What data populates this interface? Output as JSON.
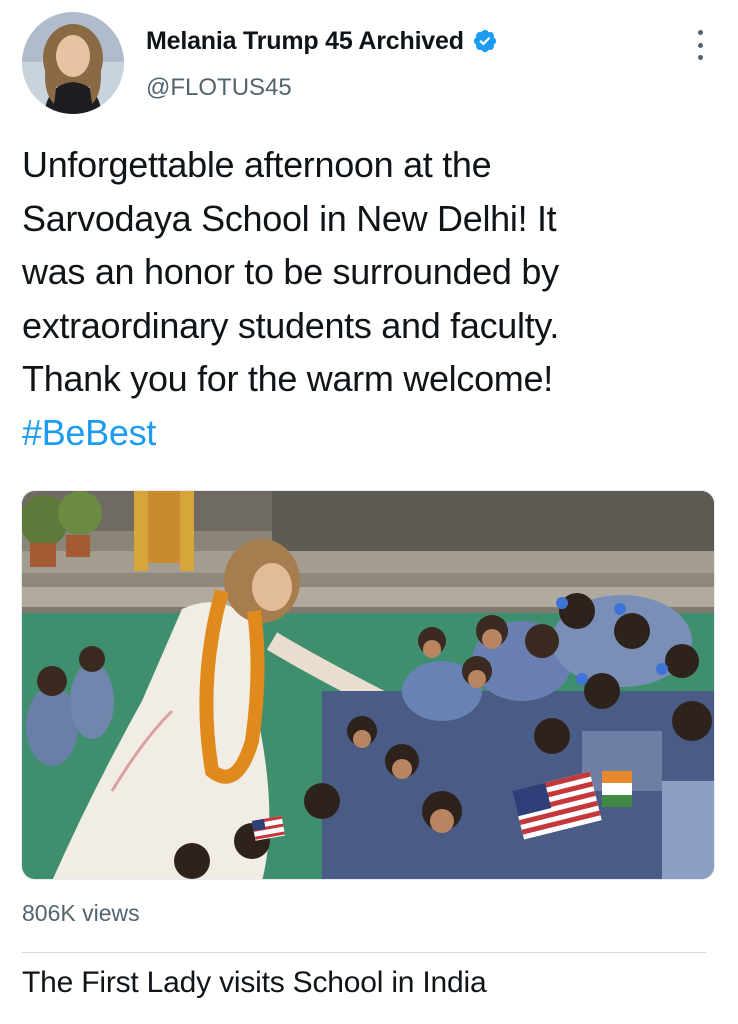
{
  "author": {
    "display_name": "Melania Trump 45 Archived",
    "handle": "@FLOTUS45",
    "verified": true,
    "avatar_icon": "profile-photo"
  },
  "tweet": {
    "text_lines": [
      "Unforgettable afternoon at the",
      "Sarvodaya School in New Delhi! It",
      "was an honor to be surrounded by",
      "extraordinary students and faculty.",
      "Thank you for the warm welcome!"
    ],
    "hashtag": "#BeBest"
  },
  "media": {
    "type": "video",
    "views": "806K views",
    "title": "The First Lady visits School in India"
  },
  "colors": {
    "text": "#0f1419",
    "secondary": "#536471",
    "accent": "#1d9bf0",
    "verified_badge": "#1d9bf0",
    "divider": "#cfd9de"
  },
  "icons": {
    "verified": "verified-badge-icon",
    "more": "more-options-icon"
  }
}
